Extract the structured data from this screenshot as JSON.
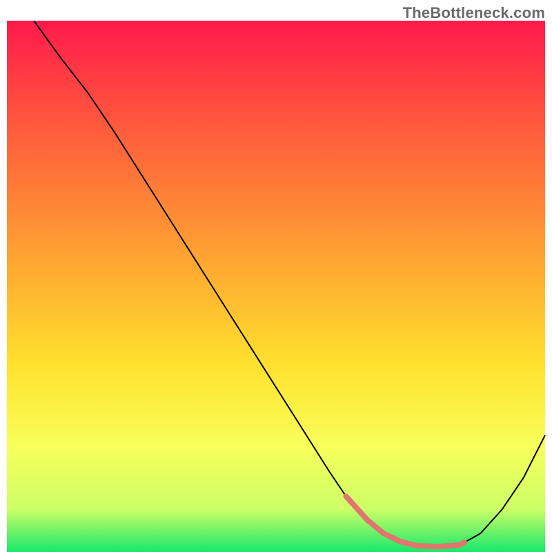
{
  "watermark": "TheBottleneck.com",
  "chart_data": {
    "type": "line",
    "title": "",
    "xlabel": "",
    "ylabel": "",
    "xlim": [
      0,
      100
    ],
    "ylim": [
      0,
      100
    ],
    "grid": false,
    "legend": false,
    "gradient_stops": [
      {
        "offset": 0,
        "color": "#ff1a4b"
      },
      {
        "offset": 0.2,
        "color": "#ff5a3c"
      },
      {
        "offset": 0.45,
        "color": "#ffa531"
      },
      {
        "offset": 0.65,
        "color": "#ffe22e"
      },
      {
        "offset": 0.8,
        "color": "#f8ff5a"
      },
      {
        "offset": 0.92,
        "color": "#ccff66"
      },
      {
        "offset": 1.0,
        "color": "#17e86b"
      }
    ],
    "series": [
      {
        "name": "bottleneck-curve",
        "color": "#000000",
        "width": 2,
        "x": [
          5,
          10,
          15,
          20,
          25,
          30,
          35,
          40,
          45,
          50,
          55,
          60,
          63,
          67,
          70,
          73,
          76,
          80,
          84,
          85,
          88,
          92,
          96,
          100
        ],
        "y": [
          100,
          93,
          86.5,
          79,
          71,
          63,
          55,
          47,
          39,
          31,
          23,
          15,
          10.5,
          6,
          3.5,
          2,
          1.2,
          1,
          1.3,
          1.8,
          3.5,
          8,
          14,
          22
        ]
      },
      {
        "name": "optimal-range",
        "color": "#e0766f",
        "width": 8,
        "linecap": "round",
        "x": [
          63,
          67,
          70,
          73,
          76,
          80,
          84,
          85
        ],
        "y": [
          10.5,
          6,
          3.5,
          2,
          1.2,
          1,
          1.3,
          1.8
        ]
      }
    ]
  }
}
